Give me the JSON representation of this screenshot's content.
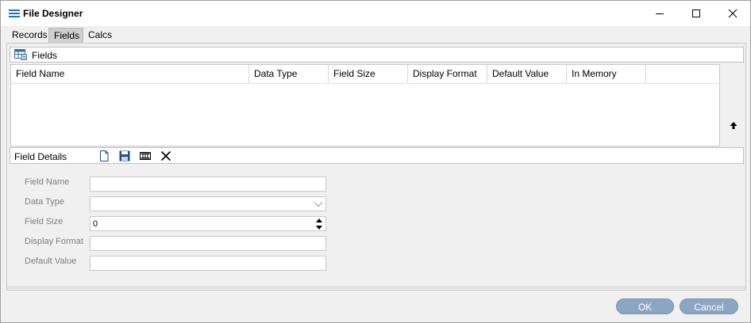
{
  "window": {
    "title": "File Designer",
    "app_icon": "list-icon"
  },
  "window_controls": {
    "minimize": "minimize-icon",
    "maximize": "maximize-icon",
    "close": "close-icon"
  },
  "tabs": [
    {
      "label": "Records",
      "active": false
    },
    {
      "label": "Fields",
      "active": true
    },
    {
      "label": "Calcs",
      "active": false
    }
  ],
  "fields_section": {
    "label": "Fields",
    "icon": "table-icon",
    "columns": [
      "Field Name",
      "Data Type",
      "Field Size",
      "Display Format",
      "Default Value",
      "In Memory"
    ],
    "rows": []
  },
  "field_details": {
    "label": "Field Details",
    "toolbar": [
      "new-document-icon",
      "save-icon",
      "film-strip-icon",
      "delete-x-icon"
    ],
    "form": {
      "field_name": {
        "label": "Field Name",
        "value": ""
      },
      "data_type": {
        "label": "Data Type",
        "value": ""
      },
      "field_size": {
        "label": "Field Size",
        "value": "0"
      },
      "display_format": {
        "label": "Display Format",
        "value": ""
      },
      "default_value": {
        "label": "Default Value",
        "value": ""
      }
    }
  },
  "buttons": {
    "ok": "OK",
    "cancel": "Cancel"
  },
  "colors": {
    "button_bg": "#8ca5c3",
    "button_text": "#ffffff",
    "app_icon": "#1e73be"
  }
}
